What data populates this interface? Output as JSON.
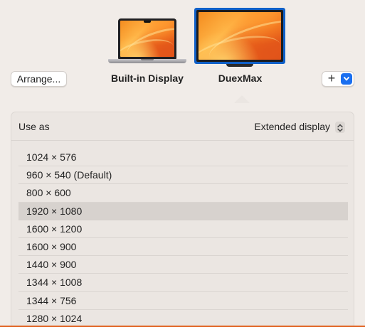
{
  "toolbar": {
    "arrange_label": "Arrange...",
    "add_label": "+"
  },
  "displays": [
    {
      "name": "Built-in Display",
      "selected": false,
      "icon": "laptop-icon"
    },
    {
      "name": "DuexMax",
      "selected": true,
      "icon": "monitor-icon"
    }
  ],
  "settings": {
    "use_as_label": "Use as",
    "use_as_value": "Extended display"
  },
  "resolutions": [
    {
      "label": "1024 × 576",
      "selected": false
    },
    {
      "label": "960 × 540 (Default)",
      "selected": false
    },
    {
      "label": "800 × 600",
      "selected": false
    },
    {
      "label": "1920 × 1080",
      "selected": true
    },
    {
      "label": "1600 × 1200",
      "selected": false
    },
    {
      "label": "1600 × 900",
      "selected": false
    },
    {
      "label": "1440 × 900",
      "selected": false
    },
    {
      "label": "1344 × 1008",
      "selected": false
    },
    {
      "label": "1344 × 756",
      "selected": false
    },
    {
      "label": "1280 × 1024",
      "selected": false
    }
  ],
  "colors": {
    "accent": "#1a6ff0",
    "selected_row": "#d7d2ce",
    "background": "#f1ece8",
    "panel": "#ebe6e2"
  }
}
